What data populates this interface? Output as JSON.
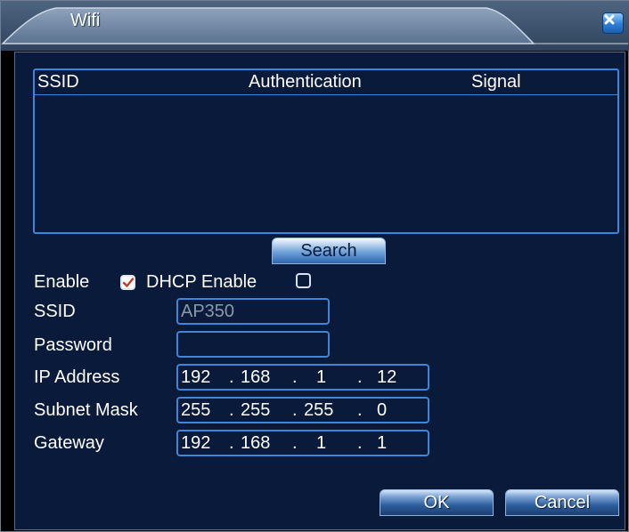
{
  "window": {
    "title": "Wifi"
  },
  "table": {
    "headers": [
      "SSID",
      "Authentication",
      "Signal"
    ],
    "rows": []
  },
  "search_label": "Search",
  "form": {
    "enable": {
      "label": "Enable",
      "checked": true
    },
    "dhcp": {
      "label": "DHCP Enable",
      "checked": false
    },
    "ssid": {
      "label": "SSID",
      "value": "AP350"
    },
    "password": {
      "label": "Password",
      "value": ""
    },
    "ip_address": {
      "label": "IP Address",
      "octets": [
        "192",
        "168",
        "1",
        "12"
      ]
    },
    "subnet_mask": {
      "label": "Subnet Mask",
      "octets": [
        "255",
        "255",
        "255",
        "0"
      ]
    },
    "gateway": {
      "label": "Gateway",
      "octets": [
        "192",
        "168",
        "1",
        "1"
      ]
    }
  },
  "buttons": {
    "ok": "OK",
    "cancel": "Cancel"
  },
  "colors": {
    "panel": "#0a1a3a",
    "border": "#3f86d8",
    "text": "#ffffff",
    "check": "#c0392b"
  }
}
